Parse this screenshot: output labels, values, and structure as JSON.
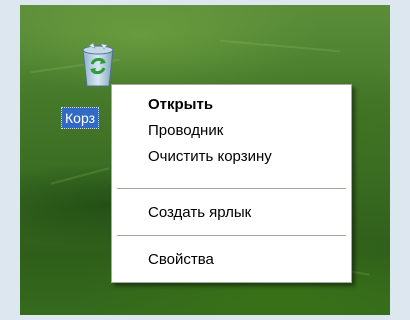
{
  "desktop": {
    "icon": {
      "name": "recycle-bin-icon",
      "label": "Корз"
    }
  },
  "context_menu": {
    "items": [
      {
        "label": "Открыть",
        "default": true
      },
      {
        "label": "Проводник",
        "default": false
      },
      {
        "label": "Очистить корзину",
        "default": false
      },
      {
        "label": "Создать ярлык",
        "default": false
      },
      {
        "label": "Свойства",
        "default": false
      }
    ]
  },
  "colors": {
    "selection": "#316ac5",
    "menu_background": "#ffffff",
    "separator": "#aca899"
  }
}
